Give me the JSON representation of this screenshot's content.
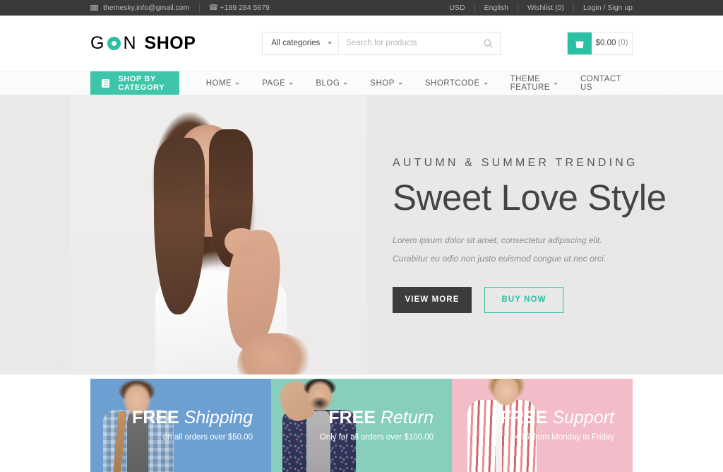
{
  "topbar": {
    "email": "themesky.info@gmail.com",
    "phone": "+189 284 5679",
    "currency": "USD",
    "language": "English",
    "wishlist": "Wishlist (0)",
    "account": "Login / Sign up"
  },
  "header": {
    "logo": {
      "part1": "G",
      "circle": "O",
      "part2": "N",
      "part3": "SHOP"
    },
    "search": {
      "category_selected": "All categories",
      "placeholder": "Search for products"
    },
    "cart": {
      "amount": "$0.00",
      "count": "(0)"
    }
  },
  "nav": {
    "shop_by_category": "SHOP BY CATEGORY",
    "items": [
      {
        "label": "HOME",
        "has_dropdown": true
      },
      {
        "label": "PAGE",
        "has_dropdown": true
      },
      {
        "label": "BLOG",
        "has_dropdown": true
      },
      {
        "label": "SHOP",
        "has_dropdown": true
      },
      {
        "label": "SHORTCODE",
        "has_dropdown": true
      },
      {
        "label": "THEME FEATURE",
        "has_dropdown": true
      },
      {
        "label": "CONTACT US",
        "has_dropdown": false
      }
    ]
  },
  "hero": {
    "eyebrow": "AUTUMN & SUMMER TRENDING",
    "title": "Sweet Love Style",
    "description": "Lorem ipsum dolor sit amet, consectetur adipiscing elit. Curabitur eu odio non justo euismod congue ut nec orci.",
    "primary_button": "VIEW MORE",
    "secondary_button": "BUY NOW"
  },
  "promos": [
    {
      "strong": "FREE",
      "emphasis": "Shipping",
      "subtitle": "on all orders over $50.00",
      "bg": "#6d9fd0"
    },
    {
      "strong": "FREE",
      "emphasis": "Return",
      "subtitle": "Only for all orders over $100.00",
      "bg": "#87cfbc"
    },
    {
      "strong": "FREE",
      "emphasis": "Support",
      "subtitle": "24 / 7 from Monday to Friday",
      "bg": "#f2bdc8"
    }
  ],
  "theme": {
    "accent": "#2bbfa4",
    "nav_accent": "#3ec6ab",
    "topbar_bg": "#3a3a3a",
    "dark_button": "#3c3c3c"
  }
}
